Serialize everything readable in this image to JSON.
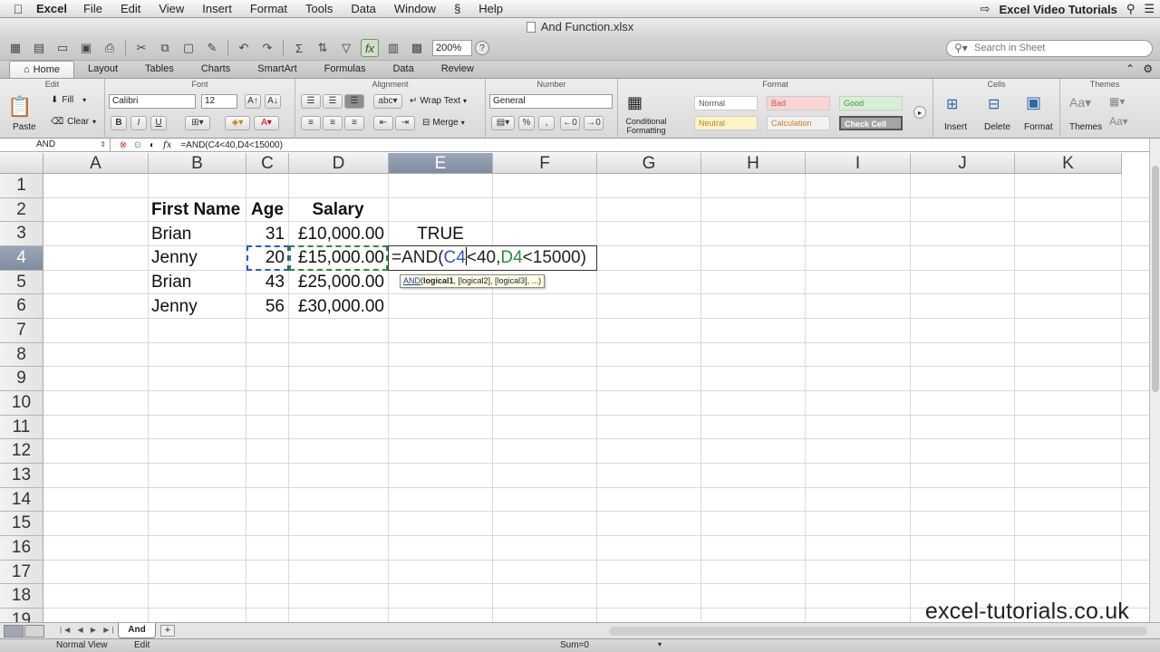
{
  "menubar": {
    "apple_icon": "",
    "app_name": "Excel",
    "menus": [
      "File",
      "Edit",
      "View",
      "Insert",
      "Format",
      "Tools",
      "Data",
      "Window",
      "Help"
    ],
    "script_icon": "§",
    "right_title": "Excel Video Tutorials"
  },
  "window": {
    "title": "And Function.xlsx"
  },
  "toolbar": {
    "zoom": "200%",
    "search_placeholder": "Search in Sheet"
  },
  "ribbon": {
    "tabs": [
      "Home",
      "Layout",
      "Tables",
      "Charts",
      "SmartArt",
      "Formulas",
      "Data",
      "Review"
    ],
    "groups": {
      "edit": "Edit",
      "font": "Font",
      "alignment": "Alignment",
      "number": "Number",
      "format": "Format",
      "cells": "Cells",
      "themes": "Themes"
    },
    "edit": {
      "paste": "Paste",
      "fill": "Fill",
      "clear": "Clear"
    },
    "font": {
      "name": "Calibri",
      "size": "12"
    },
    "alignment": {
      "wrap": "Wrap Text",
      "merge": "Merge",
      "abc": "abc"
    },
    "number": {
      "format": "General"
    },
    "format": {
      "conditional": "Conditional\nFormatting",
      "styles": [
        "Normal",
        "Bad",
        "Good",
        "Neutral",
        "Calculation",
        "Check Cell"
      ]
    },
    "cells": {
      "insert": "Insert",
      "delete": "Delete",
      "format": "Format"
    },
    "themes": {
      "label": "Themes"
    }
  },
  "formula_bar": {
    "name_box": "AND",
    "fx": "fx",
    "formula": "=AND(C4<40,D4<15000)"
  },
  "grid": {
    "columns": [
      "A",
      "B",
      "C",
      "D",
      "E",
      "F",
      "G",
      "H",
      "I",
      "J",
      "K"
    ],
    "rows": [
      "1",
      "2",
      "3",
      "4",
      "5",
      "6",
      "7",
      "8",
      "9",
      "10",
      "11",
      "12",
      "13",
      "14",
      "15",
      "16",
      "17",
      "18",
      "19"
    ],
    "headers": {
      "b2": "First Name",
      "c2": "Age",
      "d2": "Salary"
    },
    "data": [
      {
        "name": "Brian",
        "age": "31",
        "salary": "£10,000.00",
        "result": "TRUE"
      },
      {
        "name": "Jenny",
        "age": "20",
        "salary": "£15,000.00",
        "result": ""
      },
      {
        "name": "Brian",
        "age": "43",
        "salary": "£25,000.00",
        "result": ""
      },
      {
        "name": "Jenny",
        "age": "56",
        "salary": "£30,000.00",
        "result": ""
      }
    ],
    "editing": {
      "prefix": "=AND(",
      "ref1": "C4",
      "mid": "<40,",
      "ref2": "D4",
      "suffix": "<15000)"
    },
    "tooltip": {
      "fn": "AND",
      "arg1": "logical1",
      "rest": ", [logical2], [logical3], ...)"
    }
  },
  "sheets": {
    "tabs": [
      "And"
    ],
    "add": "+"
  },
  "status": {
    "view": "Normal View",
    "mode": "Edit",
    "sum": "Sum=0"
  },
  "watermark": "excel-tutorials.co.uk"
}
